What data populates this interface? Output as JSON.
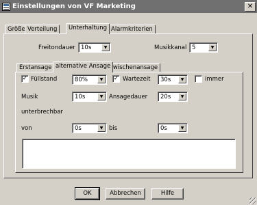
{
  "window": {
    "title": "Einstellungen von VF Marketing",
    "close_label": "✕"
  },
  "tabs": [
    "Größe",
    "Verteilung",
    "Unterhaltung",
    "Alarmkriterien"
  ],
  "unterhaltung": {
    "freitondauer_label": "Freitondauer",
    "freitondauer_value": "10s",
    "musikkanal_label": "Musikkanal",
    "musikkanal_value": "5"
  },
  "subtabs": [
    "Erstansage",
    "alternative Ansage",
    "Zwischenansage"
  ],
  "alternative": {
    "fuellstand_label": "Füllstand",
    "fuellstand_checked": "✓",
    "fuellstand_value": "80%",
    "wartezeit_label": "Wartezeit",
    "wartezeit_checked": "✓",
    "wartezeit_value": "30s",
    "immer_label": "immer",
    "musik_label": "Musik",
    "musik_value": "10s",
    "ansagedauer_label": "Ansagedauer",
    "ansagedauer_value": "20s",
    "unterbrechbar_label": "unterbrechbar",
    "von_label": "von",
    "von_value": "0s",
    "bis_label": "bis",
    "bis_value": "0s"
  },
  "buttons": {
    "ok": "OK",
    "cancel": "Abbrechen",
    "help": "Hilfe"
  },
  "icons": {
    "dropdown": "▼"
  }
}
